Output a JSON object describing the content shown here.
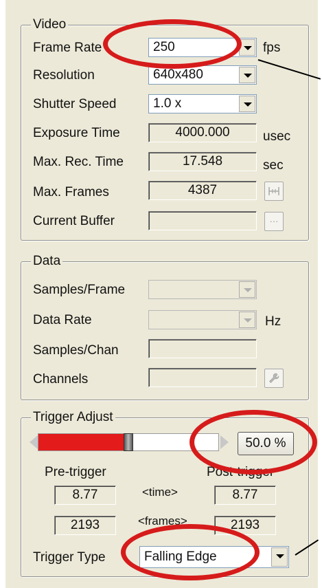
{
  "video": {
    "legend": "Video",
    "frame_rate_label": "Frame Rate",
    "frame_rate_value": "250",
    "frame_rate_unit": "fps",
    "resolution_label": "Resolution",
    "resolution_value": "640x480",
    "shutter_speed_label": "Shutter Speed",
    "shutter_speed_value": "1.0 x",
    "exposure_time_label": "Exposure Time",
    "exposure_time_value": "4000.000",
    "exposure_time_unit": "usec",
    "max_rec_time_label": "Max. Rec. Time",
    "max_rec_time_value": "17.548",
    "max_rec_time_unit": "sec",
    "max_frames_label": "Max. Frames",
    "max_frames_value": "4387",
    "current_buffer_label": "Current Buffer",
    "current_buffer_value": "",
    "ellipsis": "···"
  },
  "data": {
    "legend": "Data",
    "samples_frame_label": "Samples/Frame",
    "data_rate_label": "Data Rate",
    "data_rate_unit": "Hz",
    "samples_chan_label": "Samples/Chan",
    "channels_label": "Channels"
  },
  "trigger": {
    "legend": "Trigger Adjust",
    "slider_fraction": 0.5,
    "percent_button": "50.0 %",
    "pre_label": "Pre-trigger",
    "post_label": "Post-trigger",
    "time_label": "<time>",
    "frames_label": "<frames>",
    "pre_time": "8.77",
    "post_time": "8.77",
    "pre_frames": "2193",
    "post_frames": "2193",
    "type_label": "Trigger Type",
    "type_value": "Falling Edge"
  },
  "colors": {
    "annotation": "#d61b1b",
    "slider_fill": "#e31b1b"
  }
}
